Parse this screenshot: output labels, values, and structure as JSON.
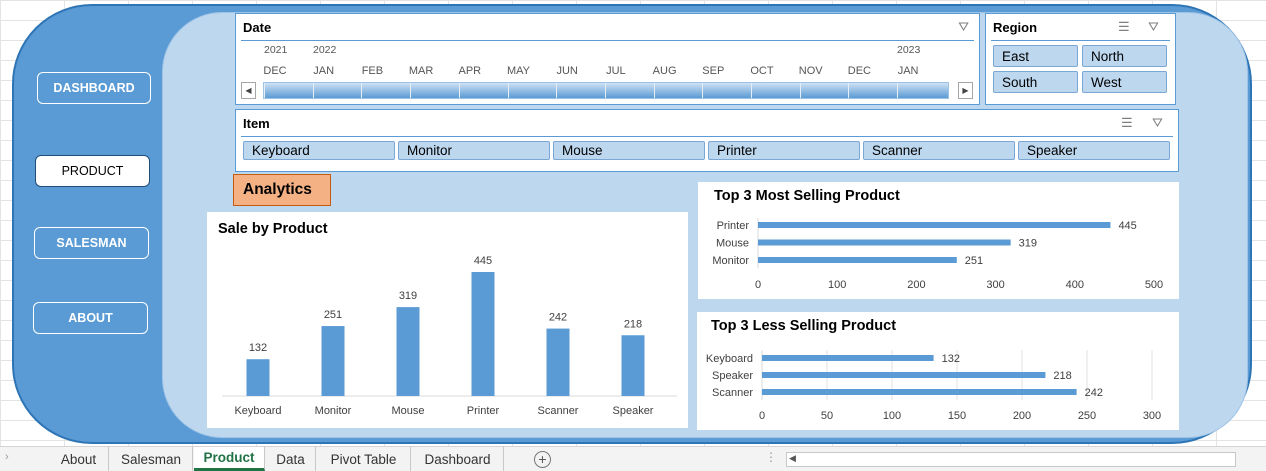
{
  "nav": {
    "dashboard": "DASHBOARD",
    "product": "PRODUCT",
    "salesman": "SALESMAN",
    "about": "ABOUT"
  },
  "date_slicer": {
    "title": "Date",
    "years": [
      "2021",
      "2022",
      "2023"
    ],
    "months": [
      "DEC",
      "JAN",
      "FEB",
      "MAR",
      "APR",
      "MAY",
      "JUN",
      "JUL",
      "AUG",
      "SEP",
      "OCT",
      "NOV",
      "DEC",
      "JAN"
    ]
  },
  "region_slicer": {
    "title": "Region",
    "items": [
      "East",
      "North",
      "South",
      "West"
    ]
  },
  "item_slicer": {
    "title": "Item",
    "items": [
      "Keyboard",
      "Monitor",
      "Mouse",
      "Printer",
      "Scanner",
      "Speaker"
    ]
  },
  "analytics_label": "Analytics",
  "colors": {
    "bar": "#5b9bd5",
    "frame": "#5b9bd5",
    "panel": "#bdd7ee",
    "highlight": "#f4b183",
    "active_tab": "#217346"
  },
  "chart_data": [
    {
      "type": "bar",
      "title": "Sale by Product",
      "categories": [
        "Keyboard",
        "Monitor",
        "Mouse",
        "Printer",
        "Scanner",
        "Speaker"
      ],
      "values": [
        132,
        251,
        319,
        445,
        242,
        218
      ],
      "ylim": [
        0,
        500
      ],
      "grid": false
    },
    {
      "type": "bar",
      "orientation": "horizontal",
      "title": "Top 3 Most Selling Product",
      "categories": [
        "Printer",
        "Mouse",
        "Monitor"
      ],
      "values": [
        445,
        319,
        251
      ],
      "xlim": [
        0,
        500
      ],
      "xticks": [
        "0",
        "100",
        "200",
        "300",
        "400",
        "500"
      ],
      "grid": false
    },
    {
      "type": "bar",
      "orientation": "horizontal",
      "title": "Top 3 Less Selling Product",
      "categories": [
        "Keyboard",
        "Speaker",
        "Scanner"
      ],
      "values": [
        132,
        218,
        242
      ],
      "xlim": [
        0,
        300
      ],
      "xticks": [
        "0",
        "50",
        "100",
        "150",
        "200",
        "250",
        "300"
      ],
      "grid": true
    }
  ],
  "sheet_tabs": {
    "items": [
      "About",
      "Salesman",
      "Product",
      "Data",
      "Pivot Table",
      "Dashboard"
    ],
    "active": "Product"
  }
}
